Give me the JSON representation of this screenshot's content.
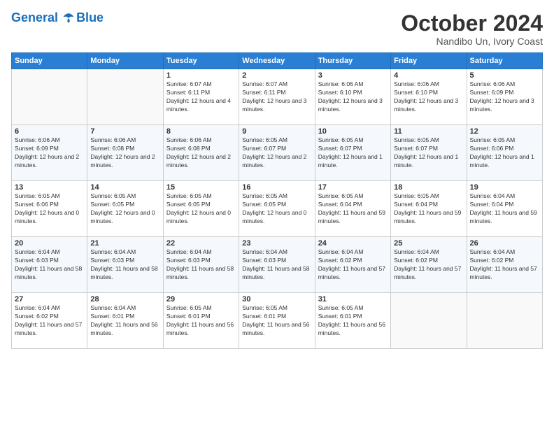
{
  "logo": {
    "line1": "General",
    "line2": "Blue"
  },
  "title": "October 2024",
  "location": "Nandibo Un, Ivory Coast",
  "days_of_week": [
    "Sunday",
    "Monday",
    "Tuesday",
    "Wednesday",
    "Thursday",
    "Friday",
    "Saturday"
  ],
  "weeks": [
    [
      {
        "day": "",
        "info": ""
      },
      {
        "day": "",
        "info": ""
      },
      {
        "day": "1",
        "info": "Sunrise: 6:07 AM\nSunset: 6:11 PM\nDaylight: 12 hours and 4 minutes."
      },
      {
        "day": "2",
        "info": "Sunrise: 6:07 AM\nSunset: 6:11 PM\nDaylight: 12 hours and 3 minutes."
      },
      {
        "day": "3",
        "info": "Sunrise: 6:06 AM\nSunset: 6:10 PM\nDaylight: 12 hours and 3 minutes."
      },
      {
        "day": "4",
        "info": "Sunrise: 6:06 AM\nSunset: 6:10 PM\nDaylight: 12 hours and 3 minutes."
      },
      {
        "day": "5",
        "info": "Sunrise: 6:06 AM\nSunset: 6:09 PM\nDaylight: 12 hours and 3 minutes."
      }
    ],
    [
      {
        "day": "6",
        "info": "Sunrise: 6:06 AM\nSunset: 6:09 PM\nDaylight: 12 hours and 2 minutes."
      },
      {
        "day": "7",
        "info": "Sunrise: 6:06 AM\nSunset: 6:08 PM\nDaylight: 12 hours and 2 minutes."
      },
      {
        "day": "8",
        "info": "Sunrise: 6:06 AM\nSunset: 6:08 PM\nDaylight: 12 hours and 2 minutes."
      },
      {
        "day": "9",
        "info": "Sunrise: 6:05 AM\nSunset: 6:07 PM\nDaylight: 12 hours and 2 minutes."
      },
      {
        "day": "10",
        "info": "Sunrise: 6:05 AM\nSunset: 6:07 PM\nDaylight: 12 hours and 1 minute."
      },
      {
        "day": "11",
        "info": "Sunrise: 6:05 AM\nSunset: 6:07 PM\nDaylight: 12 hours and 1 minute."
      },
      {
        "day": "12",
        "info": "Sunrise: 6:05 AM\nSunset: 6:06 PM\nDaylight: 12 hours and 1 minute."
      }
    ],
    [
      {
        "day": "13",
        "info": "Sunrise: 6:05 AM\nSunset: 6:06 PM\nDaylight: 12 hours and 0 minutes."
      },
      {
        "day": "14",
        "info": "Sunrise: 6:05 AM\nSunset: 6:05 PM\nDaylight: 12 hours and 0 minutes."
      },
      {
        "day": "15",
        "info": "Sunrise: 6:05 AM\nSunset: 6:05 PM\nDaylight: 12 hours and 0 minutes."
      },
      {
        "day": "16",
        "info": "Sunrise: 6:05 AM\nSunset: 6:05 PM\nDaylight: 12 hours and 0 minutes."
      },
      {
        "day": "17",
        "info": "Sunrise: 6:05 AM\nSunset: 6:04 PM\nDaylight: 11 hours and 59 minutes."
      },
      {
        "day": "18",
        "info": "Sunrise: 6:05 AM\nSunset: 6:04 PM\nDaylight: 11 hours and 59 minutes."
      },
      {
        "day": "19",
        "info": "Sunrise: 6:04 AM\nSunset: 6:04 PM\nDaylight: 11 hours and 59 minutes."
      }
    ],
    [
      {
        "day": "20",
        "info": "Sunrise: 6:04 AM\nSunset: 6:03 PM\nDaylight: 11 hours and 58 minutes."
      },
      {
        "day": "21",
        "info": "Sunrise: 6:04 AM\nSunset: 6:03 PM\nDaylight: 11 hours and 58 minutes."
      },
      {
        "day": "22",
        "info": "Sunrise: 6:04 AM\nSunset: 6:03 PM\nDaylight: 11 hours and 58 minutes."
      },
      {
        "day": "23",
        "info": "Sunrise: 6:04 AM\nSunset: 6:03 PM\nDaylight: 11 hours and 58 minutes."
      },
      {
        "day": "24",
        "info": "Sunrise: 6:04 AM\nSunset: 6:02 PM\nDaylight: 11 hours and 57 minutes."
      },
      {
        "day": "25",
        "info": "Sunrise: 6:04 AM\nSunset: 6:02 PM\nDaylight: 11 hours and 57 minutes."
      },
      {
        "day": "26",
        "info": "Sunrise: 6:04 AM\nSunset: 6:02 PM\nDaylight: 11 hours and 57 minutes."
      }
    ],
    [
      {
        "day": "27",
        "info": "Sunrise: 6:04 AM\nSunset: 6:02 PM\nDaylight: 11 hours and 57 minutes."
      },
      {
        "day": "28",
        "info": "Sunrise: 6:04 AM\nSunset: 6:01 PM\nDaylight: 11 hours and 56 minutes."
      },
      {
        "day": "29",
        "info": "Sunrise: 6:05 AM\nSunset: 6:01 PM\nDaylight: 11 hours and 56 minutes."
      },
      {
        "day": "30",
        "info": "Sunrise: 6:05 AM\nSunset: 6:01 PM\nDaylight: 11 hours and 56 minutes."
      },
      {
        "day": "31",
        "info": "Sunrise: 6:05 AM\nSunset: 6:01 PM\nDaylight: 11 hours and 56 minutes."
      },
      {
        "day": "",
        "info": ""
      },
      {
        "day": "",
        "info": ""
      }
    ]
  ]
}
